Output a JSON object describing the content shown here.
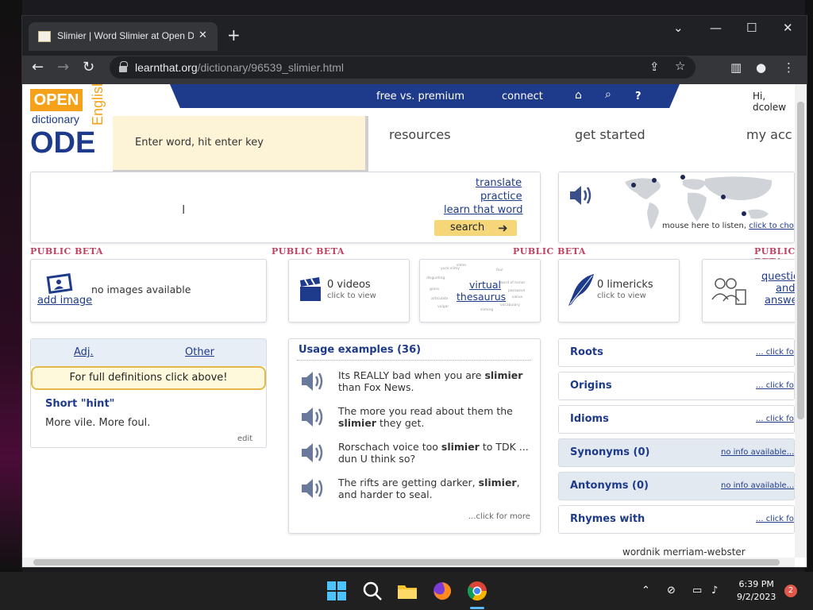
{
  "browser": {
    "tab_title": "Slimier | Word Slimier at Open Di",
    "tab_close": "✕",
    "new_tab": "+",
    "url_domain": "learnthat.org",
    "url_path": "/dictionary/96539_slimier.html",
    "window_controls": [
      "⌄",
      "—",
      "☐",
      "✕"
    ]
  },
  "site": {
    "logo_open": "OPEN",
    "logo_dictionary": "dictionary",
    "logo_english": "English",
    "logo_ode": "ODE",
    "top_nav": [
      "free vs. premium",
      "connect"
    ],
    "greeting": "Hi, dcolew",
    "entry_placeholder": "Enter word, hit enter key",
    "main_nav": [
      "resources",
      "get started",
      "my acc"
    ]
  },
  "search_panel": {
    "links": [
      "translate",
      "practice",
      "learn that word"
    ],
    "button": "search"
  },
  "map_panel": {
    "caption": "mouse here to listen,",
    "caption_link": "click to choose/add"
  },
  "beta_label": "PUBLIC BETA",
  "cards": {
    "images": {
      "link": "add image",
      "text": "no images available"
    },
    "videos": {
      "title": "0 videos",
      "sub": "click to view"
    },
    "thesaurus": {
      "line1": "virtual",
      "line2": "thesaurus"
    },
    "limericks": {
      "title": "0 limericks",
      "sub": "click to view"
    },
    "qa": {
      "line1": "questio",
      "line2": "and",
      "line3": "answe"
    }
  },
  "hint_panel": {
    "tabs": [
      "Adj.",
      "Other"
    ],
    "notice": "For full definitions click above!",
    "title": "Short \"hint\"",
    "text": "More vile. More foul.",
    "edit": "edit"
  },
  "usage": {
    "title": "Usage examples (36)",
    "examples": [
      {
        "pre": "Its REALLY bad when you are ",
        "word": "slimier",
        "post": " than Fox News."
      },
      {
        "pre": "The more you read about them the ",
        "word": "slimier",
        "post": " they get."
      },
      {
        "pre": "Rorschach voice too ",
        "word": "slimier",
        "post": " to TDK ... dun U think so?"
      },
      {
        "pre": "The rifts are getting darker, ",
        "word": "slimier",
        "post": ", and harder to seal."
      }
    ],
    "more": "...click for more"
  },
  "right_rows": [
    {
      "label": "Roots",
      "link": "... click fo",
      "blue": false
    },
    {
      "label": "Origins",
      "link": "... click fo",
      "blue": false
    },
    {
      "label": "Idioms",
      "link": "... click fo",
      "blue": false
    },
    {
      "label": "Synonyms (0)",
      "link": "no info available...",
      "blue": true
    },
    {
      "label": "Antonyms (0)",
      "link": "no info available...",
      "blue": true
    },
    {
      "label": "Rhymes with",
      "link": "... click fo",
      "blue": false
    }
  ],
  "footer_text": "wordnik     merriam-webster",
  "taskbar": {
    "time": "6:39 PM",
    "date": "9/2/2023",
    "notifications": "2"
  }
}
